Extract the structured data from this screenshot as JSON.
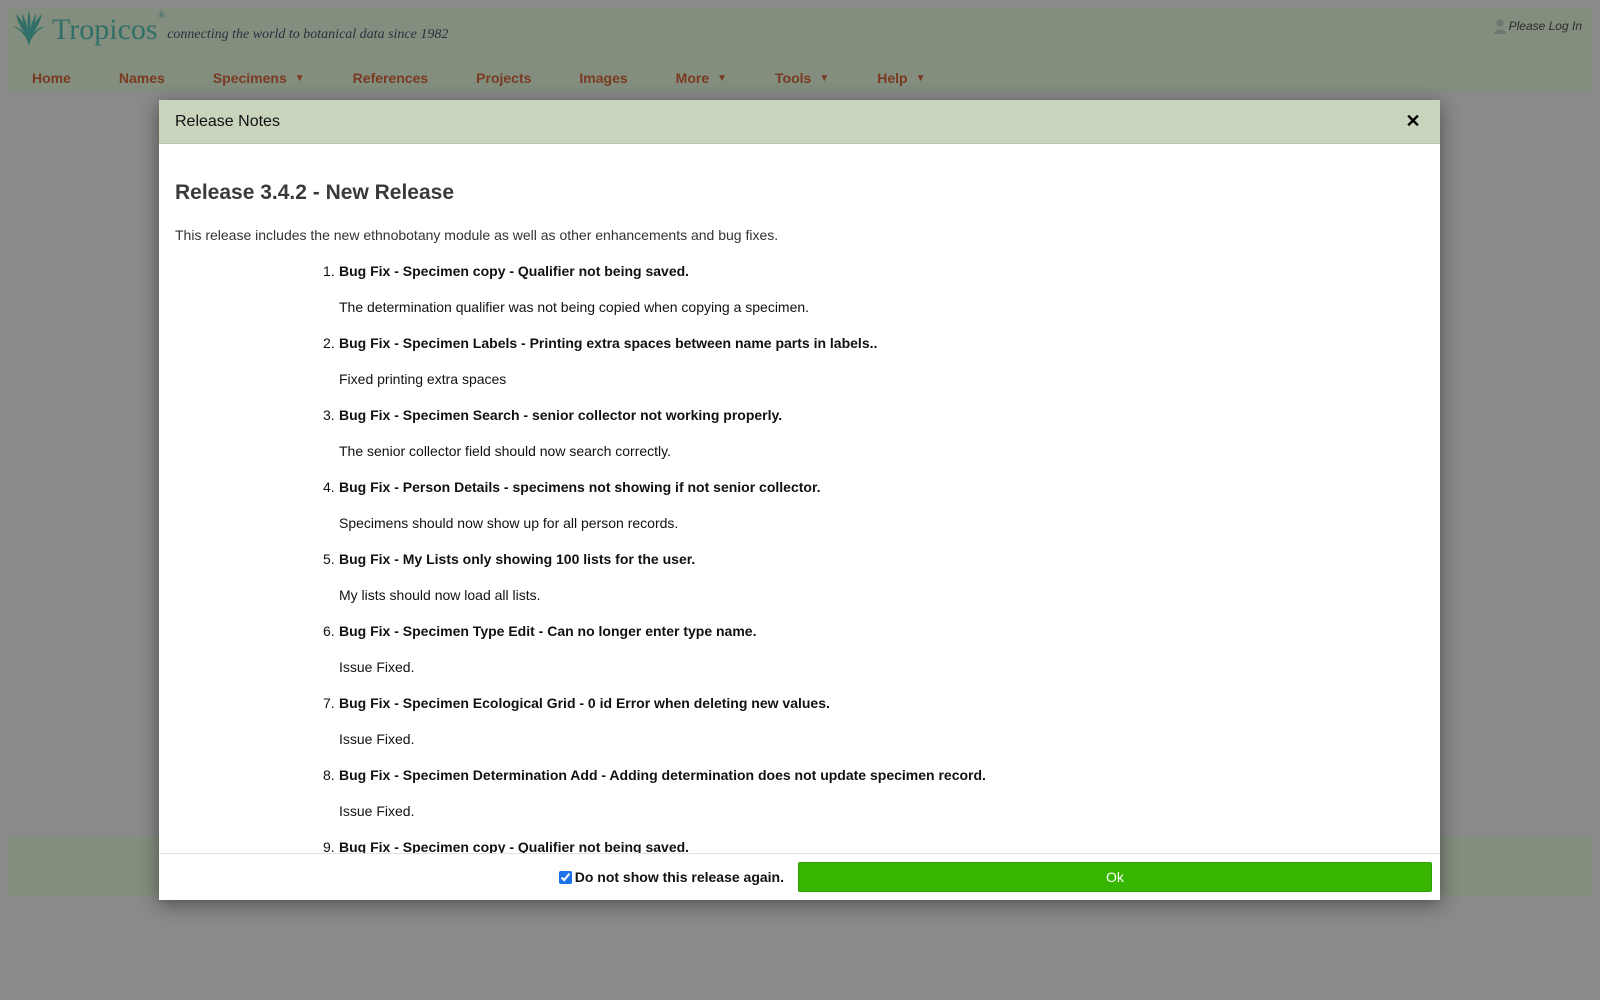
{
  "header": {
    "logo_name": "Tropicos",
    "logo_reg": "®",
    "tagline": "connecting the world to botanical data since 1982",
    "login_label": "Please Log In"
  },
  "nav": [
    {
      "label": "Home",
      "dropdown": false
    },
    {
      "label": "Names",
      "dropdown": false
    },
    {
      "label": "Specimens",
      "dropdown": true
    },
    {
      "label": "References",
      "dropdown": false
    },
    {
      "label": "Projects",
      "dropdown": false
    },
    {
      "label": "Images",
      "dropdown": false
    },
    {
      "label": "More",
      "dropdown": true
    },
    {
      "label": "Tools",
      "dropdown": true
    },
    {
      "label": "Help",
      "dropdown": true
    }
  ],
  "dropdown_glyph": "▼",
  "modal": {
    "title": "Release Notes",
    "close_glyph": "✕",
    "heading": "Release 3.4.2 - New Release",
    "intro": "This release includes the new ethnobotany module as well as other enhancements and bug fixes.",
    "notes": [
      {
        "num": "1.",
        "title": "Bug Fix - Specimen copy - Qualifier not being saved.",
        "desc": "The determination qualifier was not being copied when copying a specimen."
      },
      {
        "num": "2.",
        "title": "Bug Fix - Specimen Labels - Printing extra spaces between name parts in labels..",
        "desc": "Fixed printing extra spaces"
      },
      {
        "num": "3.",
        "title": "Bug Fix - Specimen Search - senior collector not working properly.",
        "desc": "The senior collector field should now search correctly."
      },
      {
        "num": "4.",
        "title": "Bug Fix - Person Details - specimens not showing if not senior collector.",
        "desc": "Specimens should now show up for all person records."
      },
      {
        "num": "5.",
        "title": "Bug Fix - My Lists only showing 100 lists for the user.",
        "desc": "My lists should now load all lists."
      },
      {
        "num": "6.",
        "title": "Bug Fix - Specimen Type Edit - Can no longer enter type name.",
        "desc": "Issue Fixed."
      },
      {
        "num": "7.",
        "title": "Bug Fix - Specimen Ecological Grid - 0 id Error when deleting new values.",
        "desc": "Issue Fixed."
      },
      {
        "num": "8.",
        "title": "Bug Fix - Specimen Determination Add - Adding determination does not update specimen record.",
        "desc": "Issue Fixed."
      },
      {
        "num": "9.",
        "title": "Bug Fix - Specimen copy - Qualifier not being saved.",
        "desc": ""
      }
    ],
    "dont_show_label": "Do not show this release again.",
    "dont_show_checked": true,
    "ok_label": "Ok"
  },
  "colors": {
    "header_bg": "#848e7e",
    "nav_link": "#7a3a22",
    "modal_header_bg": "#c9d4bd",
    "ok_button": "#36b600"
  }
}
